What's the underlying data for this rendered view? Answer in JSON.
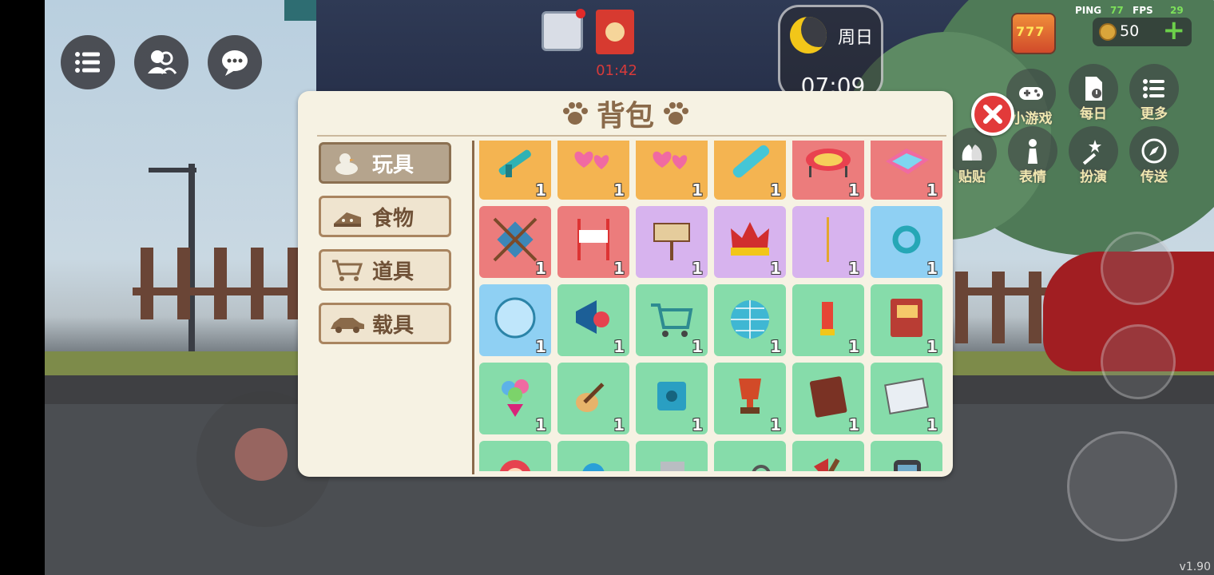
{
  "hud": {
    "red_packet_timer": "01:42",
    "day": "周日",
    "time": "07:09",
    "ping_label": "PING",
    "ping_value": "77",
    "fps_label": "FPS",
    "fps_value": "29",
    "slot_text": "777",
    "coins": "50",
    "version": "v1.90"
  },
  "menu": {
    "minigame": "小游戏",
    "daily": "每日",
    "more": "更多",
    "sticker": "贴贴",
    "emote": "表情",
    "roleplay": "扮演",
    "teleport": "传送"
  },
  "backpack": {
    "title": "背包",
    "tabs": [
      {
        "label": "玩具",
        "icon": "duck-icon",
        "active": true
      },
      {
        "label": "食物",
        "icon": "cake-icon",
        "active": false
      },
      {
        "label": "道具",
        "icon": "cart-icon",
        "active": false
      },
      {
        "label": "载具",
        "icon": "car-icon",
        "active": false
      }
    ],
    "items": [
      {
        "name": "water-gun-icon",
        "bg": "orange",
        "qty": "1"
      },
      {
        "name": "hearts-icon",
        "bg": "orange",
        "qty": "1"
      },
      {
        "name": "hearts-icon",
        "bg": "orange",
        "qty": "1"
      },
      {
        "name": "bazooka-icon",
        "bg": "orange",
        "qty": "1"
      },
      {
        "name": "trampoline-icon",
        "bg": "red",
        "qty": "1"
      },
      {
        "name": "pool-icon",
        "bg": "red",
        "qty": "1"
      },
      {
        "name": "target-icon",
        "bg": "red",
        "qty": "1"
      },
      {
        "name": "banner-icon",
        "bg": "red",
        "qty": "1"
      },
      {
        "name": "signboard-icon",
        "bg": "purple",
        "qty": "1"
      },
      {
        "name": "crown-icon",
        "bg": "purple",
        "qty": "1"
      },
      {
        "name": "wand-icon",
        "bg": "purple",
        "qty": "1"
      },
      {
        "name": "ring-icon",
        "bg": "blue",
        "qty": "1"
      },
      {
        "name": "bubble-icon",
        "bg": "blue",
        "qty": "1"
      },
      {
        "name": "megaphone-icon",
        "bg": "green",
        "qty": "1"
      },
      {
        "name": "shopping-cart-icon",
        "bg": "green",
        "qty": "1"
      },
      {
        "name": "disco-ball-icon",
        "bg": "green",
        "qty": "1"
      },
      {
        "name": "firework-icon",
        "bg": "green",
        "qty": "1"
      },
      {
        "name": "book-icon",
        "bg": "green",
        "qty": "1"
      },
      {
        "name": "bouquet-icon",
        "bg": "green",
        "qty": "1"
      },
      {
        "name": "guitar-icon",
        "bg": "green",
        "qty": "1"
      },
      {
        "name": "safe-icon",
        "bg": "green",
        "qty": "1"
      },
      {
        "name": "trophy-icon",
        "bg": "green",
        "qty": "1"
      },
      {
        "name": "notebook-icon",
        "bg": "green",
        "qty": "1"
      },
      {
        "name": "newspaper-icon",
        "bg": "green",
        "qty": "1"
      },
      {
        "name": "doll-icon",
        "bg": "green",
        "qty": ""
      },
      {
        "name": "doll-blue-icon",
        "bg": "green",
        "qty": ""
      },
      {
        "name": "card-icon",
        "bg": "green",
        "qty": ""
      },
      {
        "name": "whip-icon",
        "bg": "green",
        "qty": ""
      },
      {
        "name": "axe-icon",
        "bg": "green",
        "qty": ""
      },
      {
        "name": "phone-icon",
        "bg": "green",
        "qty": ""
      }
    ]
  },
  "colors": {
    "orange": "#f4b451",
    "red": "#ec7c7c",
    "purple": "#d7b3ee",
    "blue": "#8fd0f3",
    "green": "#86dcaa",
    "panel": "#f6f2e3",
    "accent_brown": "#8a6a4a"
  }
}
